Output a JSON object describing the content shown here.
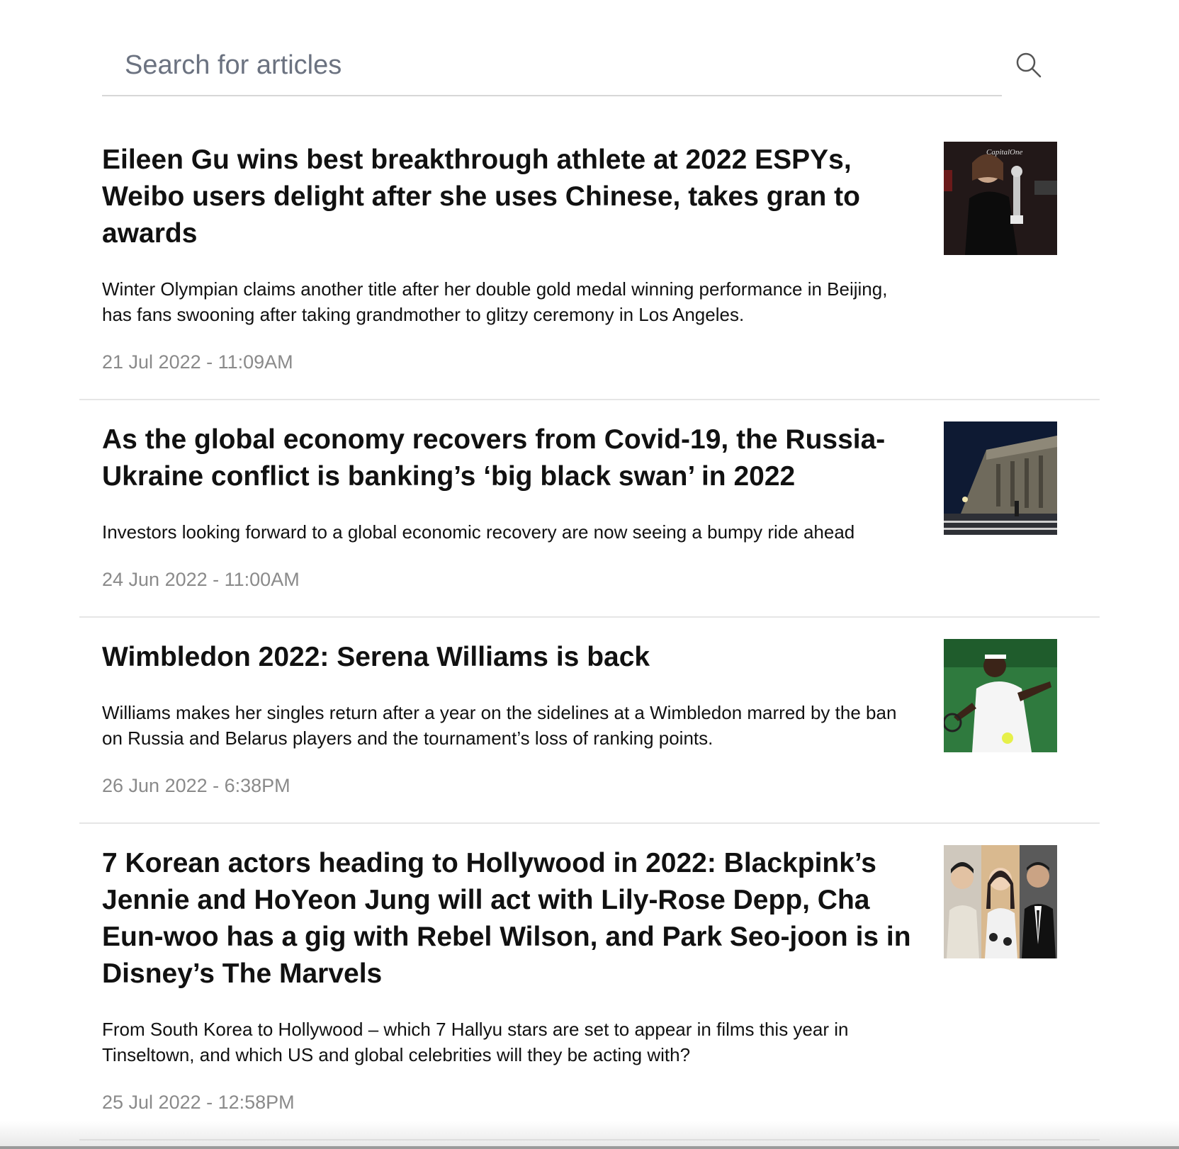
{
  "search": {
    "placeholder": "Search for articles",
    "icon": "search-icon"
  },
  "articles": [
    {
      "title": "Eileen Gu wins best breakthrough athlete at 2022 ESPYs, Weibo users delight after she uses Chinese, takes gran to awards",
      "summary": "Winter Olympian claims another title after her double gold medal winning performance in Beijing, has fans swooning after taking grandmother to glitzy ceremony in Los Angeles.",
      "date": "21 Jul 2022 - 11:09AM",
      "thumbnail_text": "CapitalOne"
    },
    {
      "title": "As the global economy recovers from Covid-19, the Russia-Ukraine conflict is banking’s ‘big black swan’ in 2022",
      "summary": "Investors looking forward to a global economic recovery are now seeing a bumpy ride ahead",
      "date": "24 Jun 2022 - 11:00AM"
    },
    {
      "title": "Wimbledon 2022: Serena Williams is back",
      "summary": "Williams makes her singles return after a year on the sidelines at a Wimbledon marred by the ban on Russia and Belarus players and the tournament’s loss of ranking points.",
      "date": "26 Jun 2022 - 6:38PM"
    },
    {
      "title": "7 Korean actors heading to Hollywood in 2022: Blackpink’s Jennie and HoYeon Jung will act with Lily-Rose Depp, Cha Eun-woo has a gig with Rebel Wilson, and Park Seo-joon is in Disney’s The Marvels",
      "summary": "From South Korea to Hollywood – which 7 Hallyu stars are set to appear in films this year in Tinseltown, and which US and global celebrities will they be acting with?",
      "date": "25 Jul 2022 - 12:58PM"
    }
  ]
}
